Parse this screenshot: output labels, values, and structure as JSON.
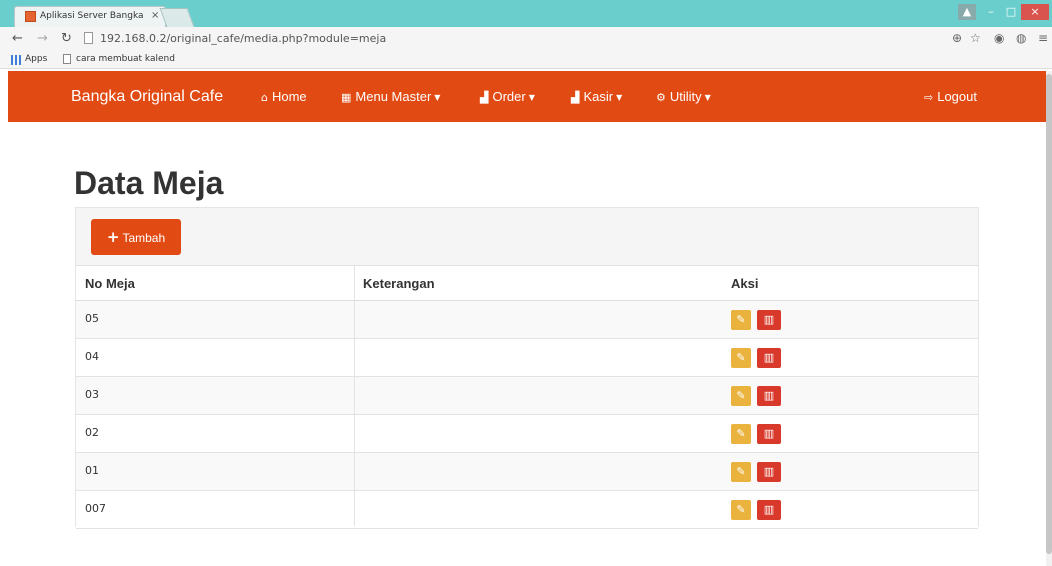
{
  "browser": {
    "tab_title": "Aplikasi Server Bangka O",
    "url": "192.168.0.2/original_cafe/media.php?module=meja",
    "bookmarks": [
      {
        "label": "Apps"
      },
      {
        "label": "cara membuat kalend"
      }
    ]
  },
  "navbar": {
    "brand": "Bangka Original Cafe",
    "items": [
      {
        "label": "Home",
        "icon": "home-icon",
        "glyph": "⌂",
        "dropdown": false
      },
      {
        "label": "Menu Master",
        "icon": "grid-icon",
        "glyph": "▦",
        "dropdown": true
      },
      {
        "label": "Order",
        "icon": "bar-chart-icon",
        "glyph": "▟",
        "dropdown": true
      },
      {
        "label": "Kasir",
        "icon": "bar-chart-icon",
        "glyph": "▟",
        "dropdown": true
      },
      {
        "label": "Utility",
        "icon": "gear-icon",
        "glyph": "⚙",
        "dropdown": true
      }
    ],
    "logout": {
      "label": "Logout",
      "icon": "logout-icon",
      "glyph": "⇨"
    }
  },
  "page": {
    "title": "Data Meja",
    "add_button": "Tambah",
    "columns": {
      "no": "No Meja",
      "keterangan": "Keterangan",
      "aksi": "Aksi"
    },
    "rows": [
      {
        "no": "05",
        "keterangan": ""
      },
      {
        "no": "04",
        "keterangan": ""
      },
      {
        "no": "03",
        "keterangan": ""
      },
      {
        "no": "02",
        "keterangan": ""
      },
      {
        "no": "01",
        "keterangan": ""
      },
      {
        "no": "007",
        "keterangan": ""
      }
    ],
    "action_icons": {
      "edit": "edit-icon",
      "delete": "trash-icon"
    }
  },
  "colors": {
    "brand_orange": "#e24a13",
    "edit_yellow": "#e9b33e",
    "delete_red": "#d9392b"
  }
}
